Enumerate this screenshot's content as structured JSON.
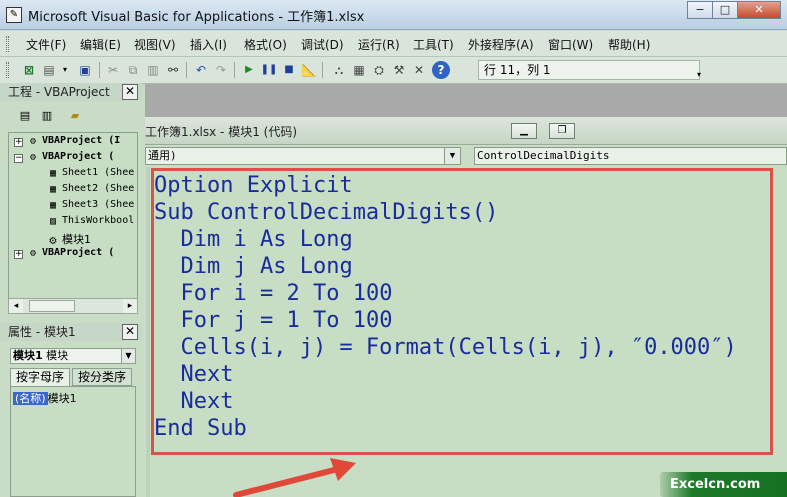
{
  "window": {
    "title": "Microsoft Visual Basic for Applications - 工作簿1.xlsx",
    "controls": [
      "−",
      "□",
      "✕"
    ]
  },
  "menubar": {
    "items": [
      "文件(F)",
      "编辑(E)",
      "视图(V)",
      "插入(I)",
      "格式(O)",
      "调试(D)",
      "运行(R)",
      "工具(T)",
      "外接程序(A)",
      "窗口(W)",
      "帮助(H)"
    ]
  },
  "toolbar": {
    "position": "行 11，列 1"
  },
  "project_panel": {
    "title": "工程 - VBAProject",
    "close": "✕",
    "tree": [
      {
        "label": "VBAProject (I"
      },
      {
        "label": "VBAProject ("
      },
      {
        "label": "Sheet1 (Shee"
      },
      {
        "label": "Sheet2 (Shee"
      },
      {
        "label": "Sheet3 (Shee"
      },
      {
        "label": "ThisWorkbool"
      },
      {
        "label": "模块1"
      },
      {
        "label": "VBAProject ("
      }
    ]
  },
  "properties_panel": {
    "title": "属性 - 模块1",
    "close": "✕",
    "object_name": "模块1",
    "object_type": "模块",
    "tabs": [
      "按字母序",
      "按分类序"
    ],
    "row_key": "(名称)",
    "row_value": "模块1"
  },
  "code_window": {
    "title": "工作簿1.xlsx - 模块1 (代码)",
    "object_combo": "通用)",
    "proc_combo": "ControlDecimalDigits",
    "lines": [
      {
        "kw": "Option Explicit",
        "rest": ""
      },
      {
        "kw": "Sub",
        "rest": " ControlDecimalDigits()"
      },
      {
        "kw": "  Dim",
        "rest": " i ",
        "kw2": "As Long"
      },
      {
        "kw": "  Dim",
        "rest": " j ",
        "kw2": "As Long"
      },
      {
        "kw": "  For",
        "rest": " i = 2 ",
        "kw2": "To",
        "rest2": " 100"
      },
      {
        "kw": "  For",
        "rest": " j = 1 ",
        "kw2": "To",
        "rest2": " 100"
      },
      {
        "kw": "",
        "rest": "  Cells(i, j) = Format(Cells(i, j), ″0.000″)"
      },
      {
        "kw": "  Next",
        "rest": ""
      },
      {
        "kw": "  Next",
        "rest": ""
      },
      {
        "kw": "End Sub",
        "rest": ""
      }
    ]
  },
  "watermark": "Excelcn.com"
}
